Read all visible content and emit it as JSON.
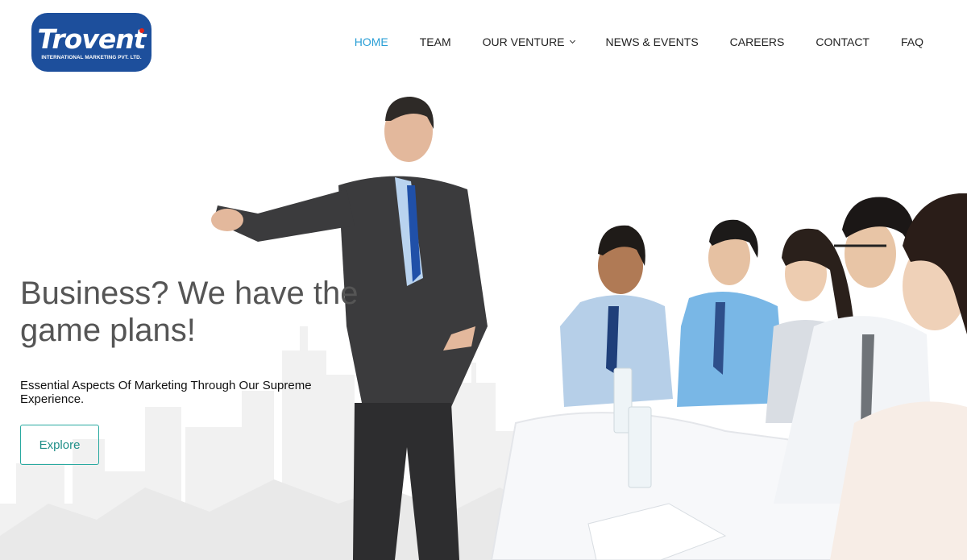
{
  "brand": {
    "name": "Trovent",
    "tagline": "INTERNATIONAL MARKETING PVT. LTD.",
    "color": "#1d4f9c",
    "accent": "#e2231a"
  },
  "nav": {
    "items": [
      {
        "label": "HOME",
        "active": true
      },
      {
        "label": "TEAM"
      },
      {
        "label": "OUR VENTURE",
        "dropdown": true
      },
      {
        "label": "NEWS & EVENTS"
      },
      {
        "label": "CAREERS"
      },
      {
        "label": "CONTACT"
      },
      {
        "label": "FAQ"
      }
    ],
    "active_color": "#2a9fd6"
  },
  "hero": {
    "title": "Business? We have the game plans!",
    "subtitle": "Essential Aspects Of Marketing Through Our Supreme Experience.",
    "button_label": "Explore",
    "button_color": "#29a9a0"
  }
}
